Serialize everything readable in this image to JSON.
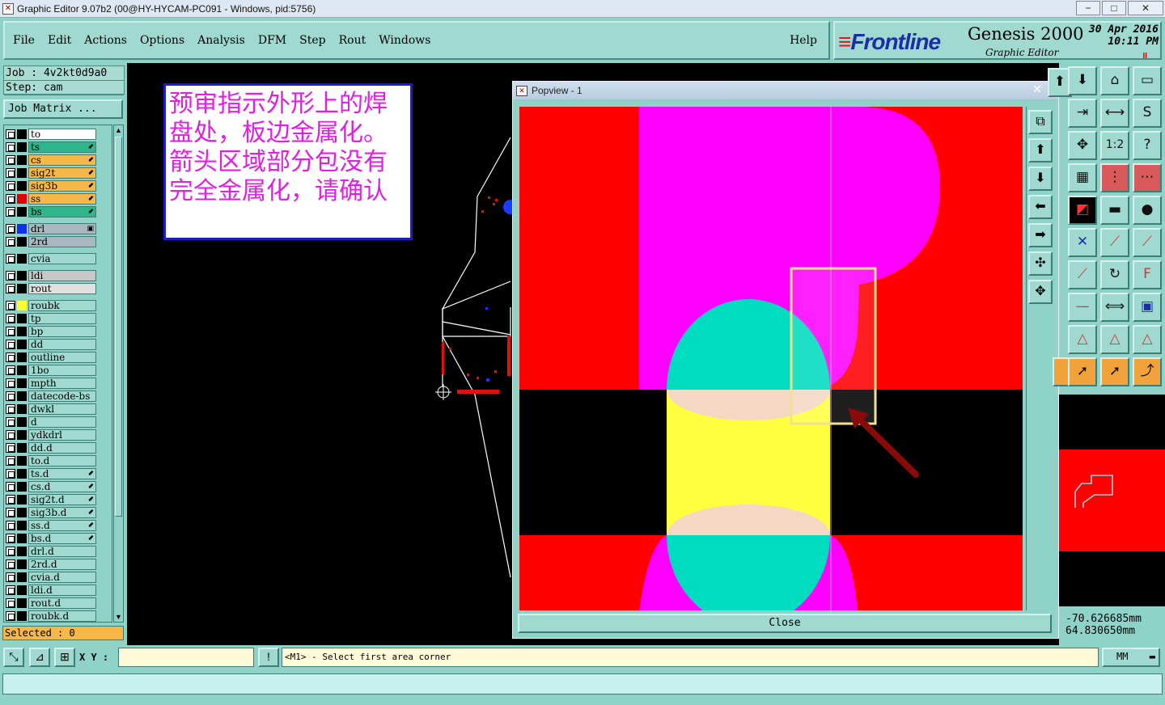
{
  "window": {
    "title": "Graphic Editor 9.07b2 (00@HY-HYCAM-PC091 - Windows, pid:5756)",
    "minimize": "−",
    "maximize": "□",
    "close": "✕"
  },
  "menu": {
    "items": [
      "File",
      "Edit",
      "Actions",
      "Options",
      "Analysis",
      "DFM",
      "Step",
      "Rout",
      "Windows"
    ],
    "help": "Help"
  },
  "brand": {
    "logo": "Frontline",
    "product": "Genesis 2000",
    "subtitle": "Graphic Editor",
    "date": "30 Apr 2016",
    "time": "10:11 PM",
    "indicator": "II"
  },
  "job": {
    "job_line": "Job : 4v2kt0d9a0",
    "step_line": "Step: cam",
    "matrix_button": "Job Matrix ..."
  },
  "layers": [
    {
      "name": "to",
      "bg": "#ffffff",
      "swatch": "",
      "mark": ""
    },
    {
      "name": "ts",
      "bg": "#2fb58a",
      "swatch": "",
      "mark": "⬋"
    },
    {
      "name": "cs",
      "bg": "#f7b84a",
      "swatch": "",
      "mark": "⬋"
    },
    {
      "name": "sig2t",
      "bg": "#f7b84a",
      "swatch": "",
      "mark": "⬋"
    },
    {
      "name": "sig3b",
      "bg": "#f7b84a",
      "swatch": "",
      "mark": "⬋"
    },
    {
      "name": "ss",
      "bg": "#f7b84a",
      "swatch": "#e00000",
      "mark": "⬋"
    },
    {
      "name": "bs",
      "bg": "#2fb58a",
      "swatch": "",
      "mark": "⬋"
    },
    {
      "name": "drl",
      "bg": "#a9b8c0",
      "swatch": "#1030f0",
      "mark": "▣"
    },
    {
      "name": "2rd",
      "bg": "#a9b8c0",
      "swatch": "",
      "mark": ""
    },
    {
      "name": "cvia",
      "bg": "#9fd9cf",
      "swatch": "",
      "mark": ""
    },
    {
      "name": "ldi",
      "bg": "#c8c8c8",
      "swatch": "",
      "mark": ""
    },
    {
      "name": "rout",
      "bg": "#e0e0e0",
      "swatch": "",
      "mark": ""
    },
    {
      "name": "roubk",
      "bg": "#9fd9cf",
      "swatch": "#ffff30",
      "mark": ""
    },
    {
      "name": "tp",
      "bg": "#9fd9cf",
      "swatch": "",
      "mark": ""
    },
    {
      "name": "bp",
      "bg": "#9fd9cf",
      "swatch": "",
      "mark": ""
    },
    {
      "name": "dd",
      "bg": "#9fd9cf",
      "swatch": "",
      "mark": ""
    },
    {
      "name": "outline",
      "bg": "#9fd9cf",
      "swatch": "",
      "mark": ""
    },
    {
      "name": "1bo",
      "bg": "#9fd9cf",
      "swatch": "",
      "mark": ""
    },
    {
      "name": "mpth",
      "bg": "#9fd9cf",
      "swatch": "",
      "mark": ""
    },
    {
      "name": "datecode-bs",
      "bg": "#9fd9cf",
      "swatch": "",
      "mark": ""
    },
    {
      "name": "dwkl",
      "bg": "#9fd9cf",
      "swatch": "",
      "mark": ""
    },
    {
      "name": "d",
      "bg": "#9fd9cf",
      "swatch": "",
      "mark": ""
    },
    {
      "name": "ydkdrl",
      "bg": "#9fd9cf",
      "swatch": "",
      "mark": ""
    },
    {
      "name": "dd.d",
      "bg": "#9fd9cf",
      "swatch": "",
      "mark": ""
    },
    {
      "name": "to.d",
      "bg": "#9fd9cf",
      "swatch": "",
      "mark": ""
    },
    {
      "name": "ts.d",
      "bg": "#9fd9cf",
      "swatch": "",
      "mark": "⬋"
    },
    {
      "name": "cs.d",
      "bg": "#9fd9cf",
      "swatch": "",
      "mark": "⬋"
    },
    {
      "name": "sig2t.d",
      "bg": "#9fd9cf",
      "swatch": "",
      "mark": "⬋"
    },
    {
      "name": "sig3b.d",
      "bg": "#9fd9cf",
      "swatch": "",
      "mark": "⬋"
    },
    {
      "name": "ss.d",
      "bg": "#9fd9cf",
      "swatch": "",
      "mark": "⬋"
    },
    {
      "name": "bs.d",
      "bg": "#9fd9cf",
      "swatch": "",
      "mark": "⬋"
    },
    {
      "name": "drl.d",
      "bg": "#9fd9cf",
      "swatch": "",
      "mark": ""
    },
    {
      "name": "2rd.d",
      "bg": "#9fd9cf",
      "swatch": "",
      "mark": ""
    },
    {
      "name": "cvia.d",
      "bg": "#9fd9cf",
      "swatch": "",
      "mark": ""
    },
    {
      "name": "ldi.d",
      "bg": "#9fd9cf",
      "swatch": "",
      "mark": ""
    },
    {
      "name": "rout.d",
      "bg": "#9fd9cf",
      "swatch": "",
      "mark": ""
    },
    {
      "name": "roubk.d",
      "bg": "#9fd9cf",
      "swatch": "",
      "mark": ""
    }
  ],
  "selected": "Selected : 0",
  "note": {
    "text": "预审指示外形上的焊盘处，板边金属化。箭头区域部分包没有完全金属化，请确认"
  },
  "popview": {
    "title": "Popview - 1",
    "close_label": "Close",
    "close_x": "✕"
  },
  "coords": {
    "x": "-70.626685mm",
    "y": "64.830650mm"
  },
  "bottom": {
    "xy_label": "X Y :",
    "xy_value": "",
    "prompt": "<M1> - Select first area corner",
    "units": "MM",
    "units_arrow": "▬"
  },
  "colors": {
    "panel": "#8fd3c8",
    "pad": "#ff00ff",
    "copper": "#ff0000",
    "drill": "#00e0c0",
    "plating": "#ffff40"
  }
}
